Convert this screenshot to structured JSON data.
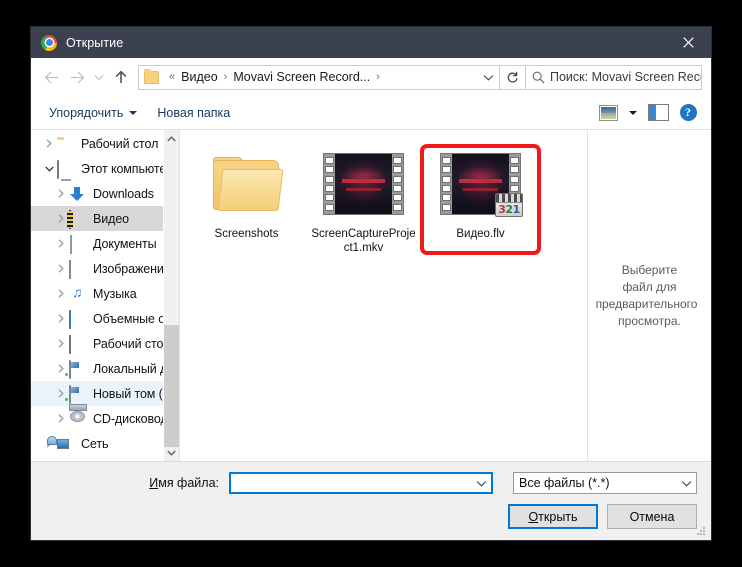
{
  "window": {
    "title": "Открытие",
    "app_icon": "chrome-icon",
    "close_label": "✕"
  },
  "nav": {
    "back_icon": "arrow-left-icon",
    "forward_icon": "arrow-right-icon",
    "recent_icon": "chevron-down-icon",
    "up_icon": "arrow-up-icon",
    "refresh_icon": "refresh-icon",
    "breadcrumb": {
      "folder_icon": "folder-icon",
      "prefix": "«",
      "items": [
        "Видео",
        "Movavi Screen Record..."
      ],
      "separator": "›",
      "trailing_separator": "›",
      "dropdown_icon": "chevron-down-icon"
    },
    "search": {
      "icon": "search-icon",
      "placeholder": "Поиск: Movavi Screen Recor..."
    }
  },
  "commandbar": {
    "organize_label": "Упорядочить",
    "new_folder_label": "Новая папка",
    "view_icon": "view-options-icon",
    "view_caret_icon": "chevron-down-icon",
    "pane_icon": "preview-pane-icon",
    "help_icon": "help-icon",
    "help_label": "?"
  },
  "sidebar": {
    "items": [
      {
        "label": "Рабочий стол",
        "icon": "folder-icon",
        "indent": 0,
        "twisty": "collapsed",
        "state": "normal"
      },
      {
        "label": "Этот компьютер",
        "icon": "computer-icon",
        "indent": 0,
        "twisty": "expanded",
        "state": "normal"
      },
      {
        "label": "Downloads",
        "icon": "downloads-icon",
        "indent": 1,
        "twisty": "collapsed",
        "state": "normal"
      },
      {
        "label": "Видео",
        "icon": "video-folder-icon",
        "indent": 1,
        "twisty": "collapsed",
        "state": "selected"
      },
      {
        "label": "Документы",
        "icon": "documents-icon",
        "indent": 1,
        "twisty": "collapsed",
        "state": "normal"
      },
      {
        "label": "Изображения",
        "icon": "pictures-icon",
        "indent": 1,
        "twisty": "collapsed",
        "state": "normal"
      },
      {
        "label": "Музыка",
        "icon": "music-icon",
        "indent": 1,
        "twisty": "collapsed",
        "state": "normal"
      },
      {
        "label": "Объемные объе",
        "icon": "3d-objects-icon",
        "indent": 1,
        "twisty": "collapsed",
        "state": "normal"
      },
      {
        "label": "Рабочий стол",
        "icon": "desktop-icon",
        "indent": 1,
        "twisty": "collapsed",
        "state": "normal"
      },
      {
        "label": "Локальный дис",
        "icon": "drive-icon",
        "indent": 1,
        "twisty": "collapsed",
        "state": "normal"
      },
      {
        "label": "Новый том (D:)",
        "icon": "drive-icon",
        "indent": 1,
        "twisty": "collapsed",
        "state": "hover"
      },
      {
        "label": "CD-дисковод (F",
        "icon": "cd-drive-icon",
        "indent": 1,
        "twisty": "collapsed",
        "state": "normal"
      },
      {
        "label": "Сеть",
        "icon": "network-icon",
        "indent": 0,
        "twisty": "collapsed",
        "state": "normal"
      }
    ],
    "scrollbar": {
      "up_icon": "chevron-up-icon",
      "down_icon": "chevron-down-icon"
    }
  },
  "files": [
    {
      "name": "Screenshots",
      "kind": "folder",
      "selected": false,
      "badge": null
    },
    {
      "name": "ScreenCaptureProject1.mkv",
      "kind": "video",
      "selected": false,
      "badge": null
    },
    {
      "name": "Видео.flv",
      "kind": "video",
      "selected": true,
      "badge": "321"
    }
  ],
  "preview": {
    "text": "Выберите файл для предварительного просмотра."
  },
  "footer": {
    "filename_label": "Имя файла:",
    "filename_accel": "И",
    "filename_value": "",
    "filetype_value": "Все файлы (*.*)",
    "combo_icon": "chevron-down-icon",
    "open_button": "Открыть",
    "open_accel": "О",
    "cancel_button": "Отмена"
  },
  "colors": {
    "titlebar": "#3c4150",
    "accent": "#0078d7",
    "highlight_red": "#f21818",
    "selection": "#d8d8d8",
    "hover": "#eaf3fb"
  }
}
